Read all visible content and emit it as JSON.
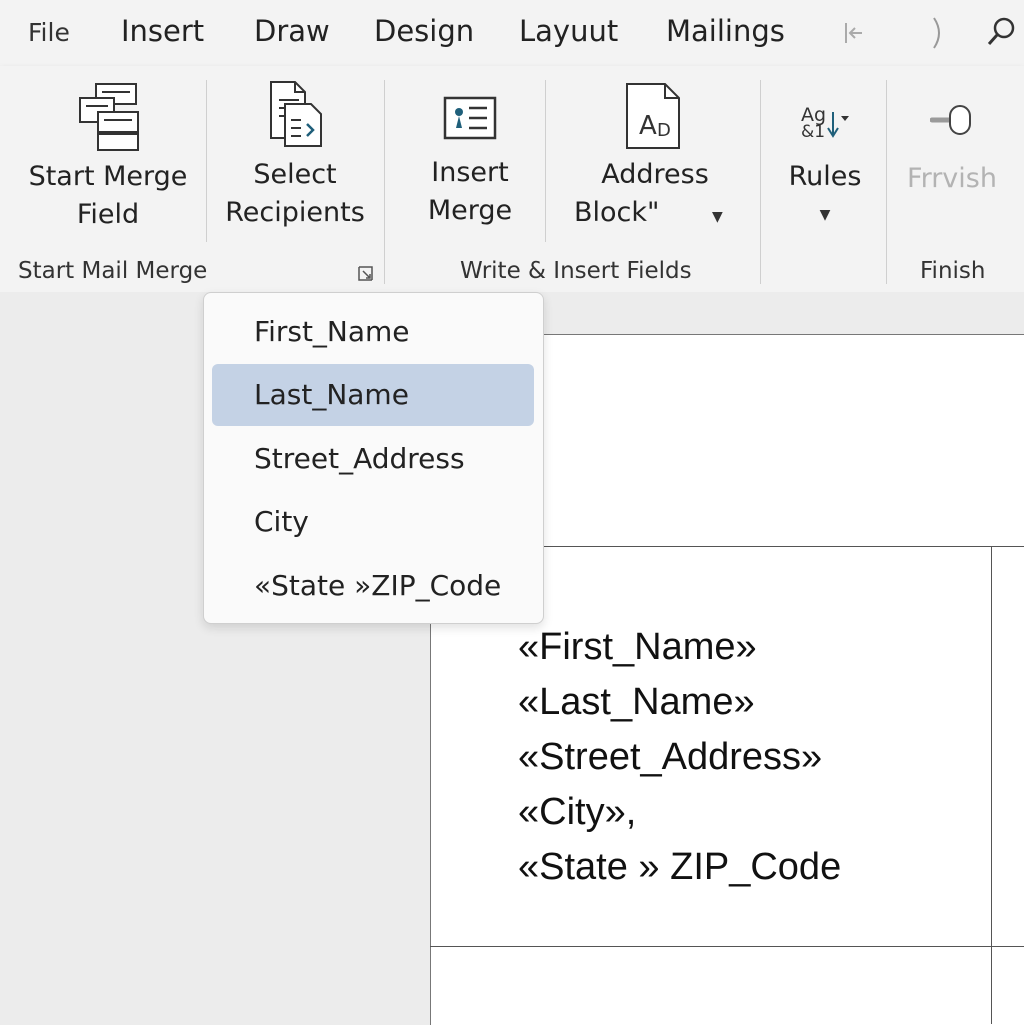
{
  "menu": {
    "tabs": [
      "File",
      "Insert",
      "Draw",
      "Design",
      "Layuut",
      "Mailings"
    ],
    "icons": [
      "exit-icon",
      "paren-icon",
      "search-icon"
    ]
  },
  "ribbon": {
    "start_merge_field": {
      "line1": "Start Merge",
      "line2": "Field"
    },
    "select_recipients": {
      "line1": "Select",
      "line2": "Recipients"
    },
    "insert_merge": {
      "line1": "Insert",
      "line2": "Merge"
    },
    "address_block": {
      "line1": "Address",
      "line2": "Block\""
    },
    "rules": {
      "label": "Rules",
      "icon_text_top": "Ag",
      "icon_text_bottom": "&1"
    },
    "finish": {
      "label": "Frrvish"
    },
    "groups": {
      "start_mail_merge": "Start Mail Merge",
      "write_insert_fields": "Write & Insert Fields",
      "finish": "Finish"
    }
  },
  "dropdown": {
    "items": [
      "First_Name",
      "Last_Name",
      "Street_Address",
      "City",
      "«State »ZIP_Code"
    ],
    "selected_index": 1
  },
  "document": {
    "address_lines": [
      "«First_Name»",
      "«Last_Name»",
      "«Street_Address»",
      "«City»,",
      "«State » ZIP_Code"
    ]
  },
  "colors": {
    "selected_item": "#c4d2e5",
    "accent_icon": "#1f5f7a"
  }
}
